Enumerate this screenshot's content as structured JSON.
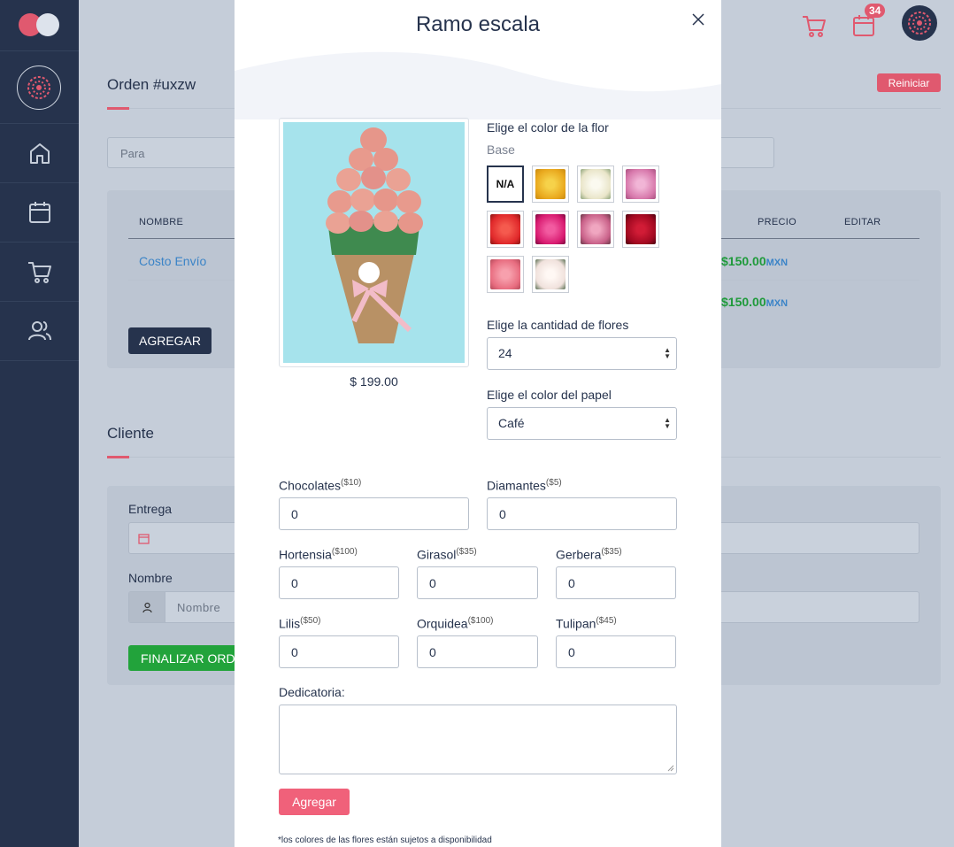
{
  "app": {
    "colors": {
      "sidebar": "#26334d",
      "accent": "#e0596f",
      "success": "#22a33b",
      "link": "#3b84c7"
    }
  },
  "topbar": {
    "calendar_badge": "34"
  },
  "sidebar": {
    "items": [
      {
        "icon": "home-icon"
      },
      {
        "icon": "calendar-icon"
      },
      {
        "icon": "cart-icon"
      },
      {
        "icon": "users-icon"
      }
    ]
  },
  "order": {
    "title": "Orden #uxzw",
    "reset_label": "Reiniciar",
    "para_placeholder": "Para",
    "table": {
      "headers": {
        "nombre": "NOMBRE",
        "precio": "PRECIO",
        "editar": "EDITAR"
      },
      "rows": [
        {
          "nombre": "Costo Envío",
          "precio": "$150.00",
          "currency": "MXN"
        }
      ],
      "total": {
        "precio": "$150.00",
        "currency": "MXN"
      }
    },
    "add_label": "AGREGAR"
  },
  "client": {
    "title": "Cliente",
    "entrega_label": "Entrega",
    "nombre_label": "Nombre",
    "nombre_placeholder": "Nombre",
    "finalize_label": "FINALIZAR ORD"
  },
  "modal": {
    "title": "Ramo escala",
    "price": "$ 199.00",
    "flower_color_label": "Elige el color de la flor",
    "base_label": "Base",
    "swatches": [
      {
        "label": "N/A",
        "selected": true
      },
      {
        "color": "#f2b827"
      },
      {
        "color": "#f3f1df"
      },
      {
        "color": "#e08ab8"
      },
      {
        "color": "#e8302f"
      },
      {
        "color": "#e0207a"
      },
      {
        "color": "#d46a90"
      },
      {
        "color": "#b00a24"
      },
      {
        "color": "#ec7c8e"
      },
      {
        "color": "#f4e9e6"
      }
    ],
    "qty_label": "Elige la cantidad de flores",
    "qty_value": "24",
    "paper_label": "Elige el color del papel",
    "paper_value": "Café",
    "extras": {
      "chocolates": {
        "label": "Chocolates",
        "price": "($10)",
        "value": "0"
      },
      "diamantes": {
        "label": "Diamantes",
        "price": "($5)",
        "value": "0"
      },
      "hortensia": {
        "label": "Hortensia",
        "price": "($100)",
        "value": "0"
      },
      "girasol": {
        "label": "Girasol",
        "price": "($35)",
        "value": "0"
      },
      "gerbera": {
        "label": "Gerbera",
        "price": "($35)",
        "value": "0"
      },
      "lilis": {
        "label": "Lilis",
        "price": "($50)",
        "value": "0"
      },
      "orquidea": {
        "label": "Orquidea",
        "price": "($100)",
        "value": "0"
      },
      "tulipan": {
        "label": "Tulipan",
        "price": "($45)",
        "value": "0"
      }
    },
    "dedication_label": "Dedicatoria:",
    "add_label": "Agregar",
    "note": "*los colores de las flores están sujetos a disponibilidad"
  }
}
